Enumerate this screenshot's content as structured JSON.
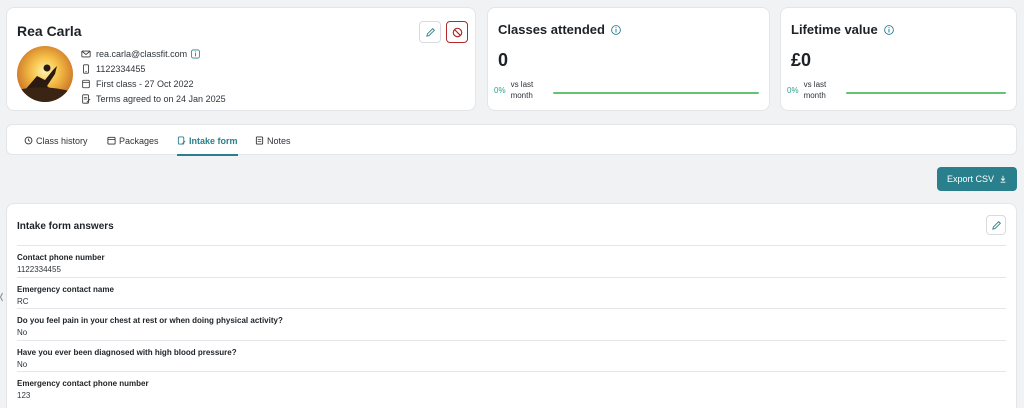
{
  "profile": {
    "name": "Rea Carla",
    "email": "rea.carla@classfit.com",
    "phone": "1122334455",
    "first_class": "First class - 27 Oct 2022",
    "terms": "Terms agreed to on 24 Jan 2025"
  },
  "stats": {
    "classes": {
      "title": "Classes attended",
      "value": "0",
      "pct": "0%",
      "vs": "vs last month"
    },
    "lifetime": {
      "title": "Lifetime value",
      "value": "£0",
      "pct": "0%",
      "vs": "vs last month"
    }
  },
  "tabs": [
    {
      "label": "Class history",
      "icon": "history-icon"
    },
    {
      "label": "Packages",
      "icon": "calendar-icon"
    },
    {
      "label": "Intake form",
      "icon": "form-icon",
      "active": true
    },
    {
      "label": "Notes",
      "icon": "note-icon"
    }
  ],
  "export_label": "Export CSV",
  "intake": {
    "title": "Intake form answers",
    "items": [
      {
        "q": "Contact phone number",
        "a": "1122334455"
      },
      {
        "q": "Emergency contact name",
        "a": "RC"
      },
      {
        "q": "Do you feel pain in your chest at rest or when doing physical activity?",
        "a": "No"
      },
      {
        "q": "Have you ever been diagnosed with high blood pressure?",
        "a": "No"
      },
      {
        "q": "Emergency contact phone number",
        "a": "123"
      }
    ]
  },
  "colors": {
    "accent": "#2a7f8c",
    "danger": "#b02a2a",
    "progress": "#62c374",
    "background": "#f1f2f4"
  }
}
